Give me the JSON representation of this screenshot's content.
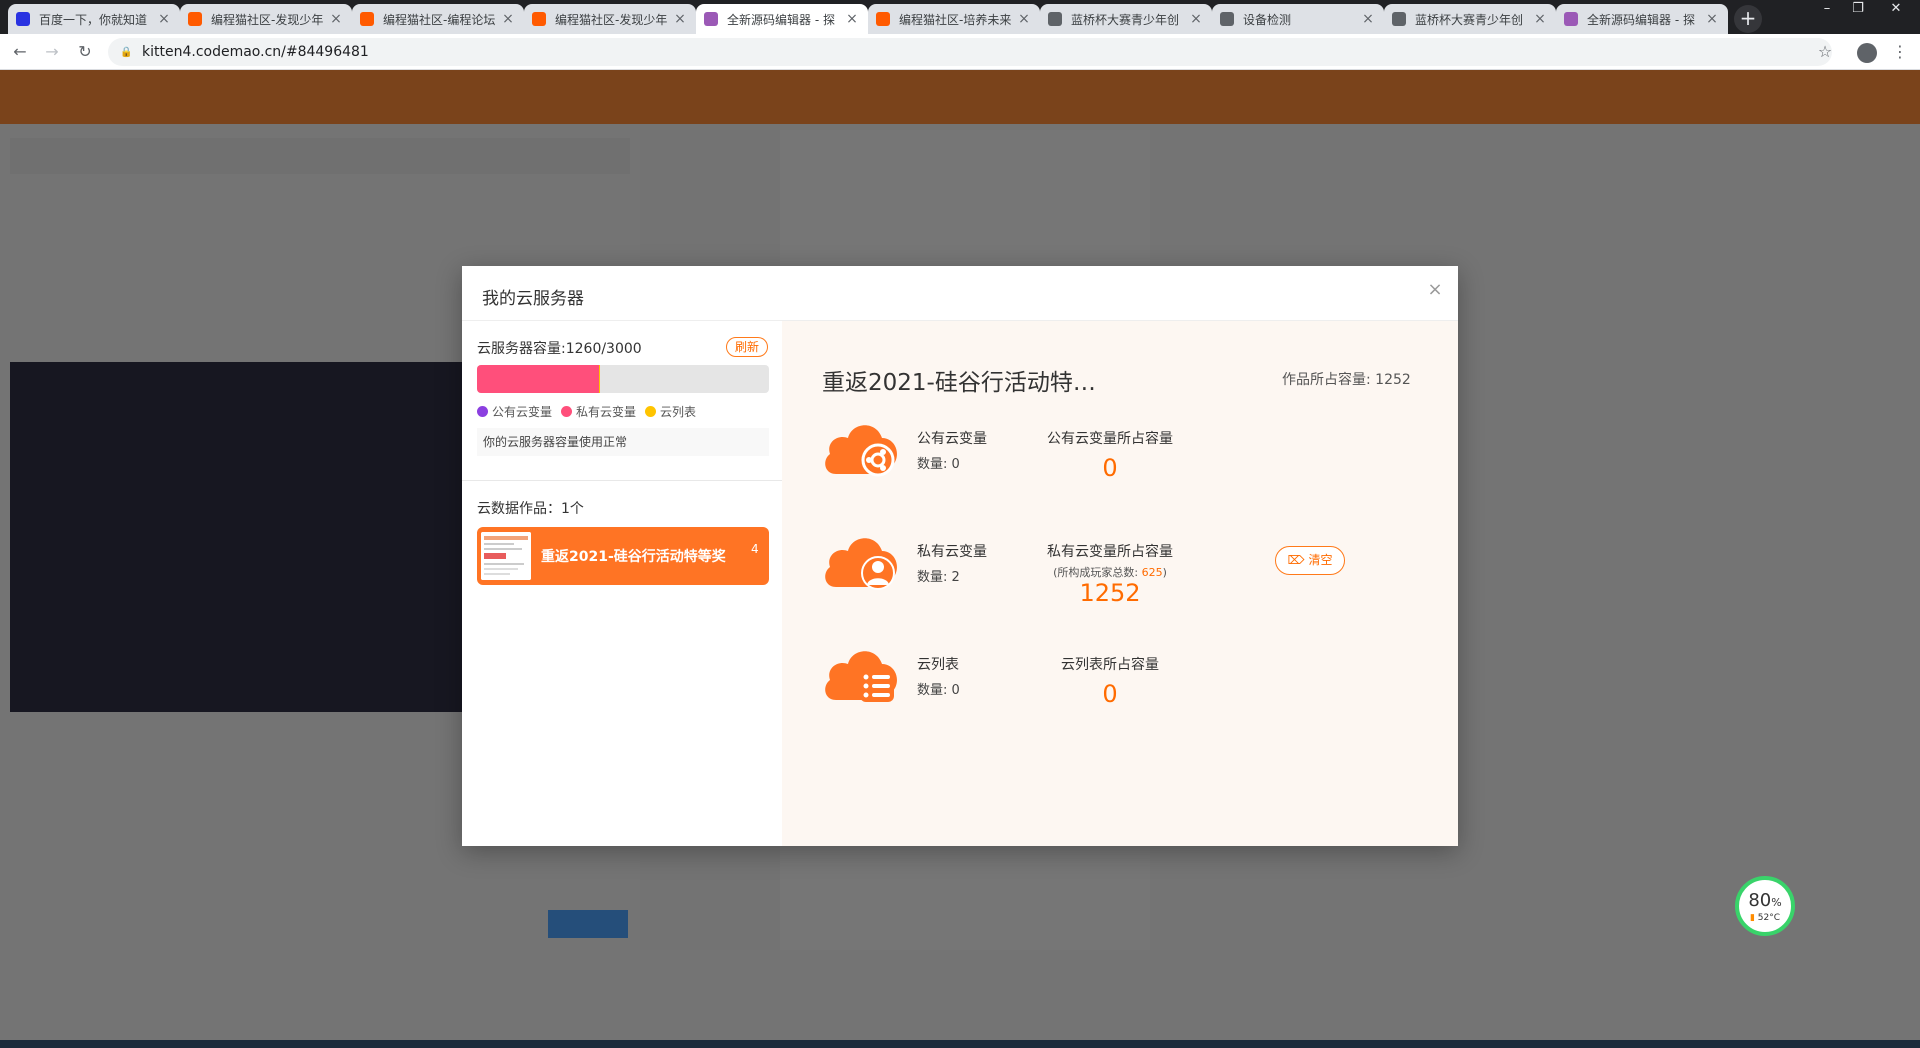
{
  "browser": {
    "tabs": [
      {
        "title": "百度一下，你就知道",
        "icon": "baidu-paw-icon",
        "color": "#2932e1"
      },
      {
        "title": "编程猫社区-发现少年",
        "icon": "codemao-cat-icon",
        "color": "#ff5a00"
      },
      {
        "title": "编程猫社区-编程论坛",
        "icon": "codemao-cat-icon",
        "color": "#ff5a00"
      },
      {
        "title": "编程猫社区-发现少年",
        "icon": "codemao-cat-icon",
        "color": "#ff5a00"
      },
      {
        "title": "全新源码编辑器 - 探",
        "icon": "kitten-editor-icon",
        "color": "#9b59b6",
        "active": true
      },
      {
        "title": "编程猫社区-培养未来",
        "icon": "codemao-cat-icon",
        "color": "#ff5a00"
      },
      {
        "title": "蓝桥杯大赛青少年创",
        "icon": "globe-icon",
        "color": "#5f6368"
      },
      {
        "title": "设备检测",
        "icon": "globe-icon",
        "color": "#5f6368"
      },
      {
        "title": "蓝桥杯大赛青少年创",
        "icon": "globe-icon",
        "color": "#5f6368"
      },
      {
        "title": "全新源码编辑器 - 探",
        "icon": "kitten-editor-icon",
        "color": "#9b59b6"
      }
    ],
    "url": "kitten4.codemao.cn/#84496481"
  },
  "modal": {
    "title": "我的云服务器",
    "capacity_label": "云服务器容量:1260/3000",
    "refresh_label": "刷新",
    "usage": {
      "total": 3000,
      "segments": [
        {
          "name": "公有云变量",
          "value": 0,
          "color": "#8b3fe0"
        },
        {
          "name": "私有云变量",
          "value": 1252,
          "color": "#ff4f7b"
        },
        {
          "name": "云列表",
          "value": 8,
          "color": "#ffc400"
        }
      ]
    },
    "legend": [
      {
        "label": "公有云变量",
        "color": "#8b3fe0"
      },
      {
        "label": "私有云变量",
        "color": "#ff4f7b"
      },
      {
        "label": "云列表",
        "color": "#ffc400"
      }
    ],
    "status": "你的云服务器容量使用正常",
    "works_label": "云数据作品：1个",
    "works": [
      {
        "name": "重返2021-硅谷行活动特等奖",
        "count": "4"
      }
    ],
    "project_title": "重返2021-硅谷行活动特…",
    "project_capacity": "作品所占容量: 1252",
    "rows": [
      {
        "label": "公有云变量",
        "count": "数量: 0",
        "cap_title": "公有云变量所占容量",
        "cap_value": "0",
        "icon": "cloud-share-icon"
      },
      {
        "label": "私有云变量",
        "count": "数量: 2",
        "cap_title": "私有云变量所占容量",
        "cap_value": "1252",
        "icon": "cloud-user-icon",
        "players_prefix": "(所构成玩家总数: ",
        "players_value": "625",
        "players_suffix": ")",
        "clear_label": "清空"
      },
      {
        "label": "云列表",
        "count": "数量: 0",
        "cap_title": "云列表所占容量",
        "cap_value": "0",
        "icon": "cloud-list-icon"
      }
    ],
    "accent": "#ff6b00"
  },
  "widget": {
    "percent": "80",
    "percent_sign": "%",
    "temp": "52°C"
  }
}
